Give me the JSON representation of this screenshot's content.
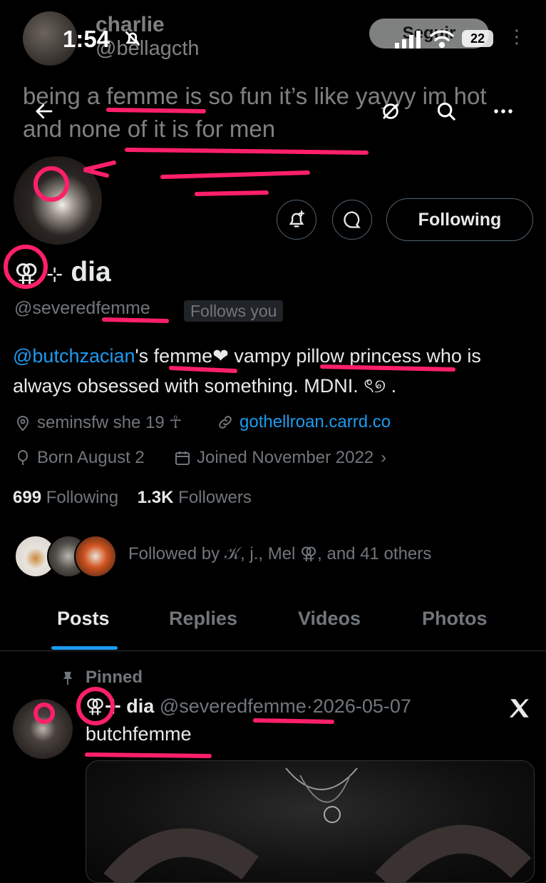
{
  "overlay_tweet": {
    "author_name": "charlie",
    "author_handle": "@bellagcth",
    "follow_label": "Seguir",
    "text": "being a femme is so fun it’s like yayyy im hot and none of it is for men"
  },
  "status_bar": {
    "time": "1:54",
    "battery": "22"
  },
  "profile": {
    "display_name_symbol": "⚢",
    "display_name_sparkle": "⊹",
    "display_name": "dia",
    "handle": "@severedfemme",
    "follows_you": "Follows you",
    "following_label": "Following",
    "bio": {
      "mention": "@butchzacian",
      "rest": "'s femme❤︎ vampy pillow princess who is always obsessed with something. MDNI. ꒰ᐢ .",
      "display_rest": "'s femme❤ vampy pillow princess who is always obsessed with something. MDNI. ৎ୭ ."
    },
    "location": "seminsfw  she  19 ☥",
    "website": "gothellroan.carrd.co",
    "birthday": "Born August 2",
    "joined": "Joined November 2022",
    "following_count": "699",
    "following_text": "Following",
    "followers_count": "1.3K",
    "followers_text": "Followers",
    "followed_by": "Followed by 𝒦, j., Mel ⚢, and 41 others"
  },
  "tabs": [
    "Posts",
    "Replies",
    "Videos",
    "Photos"
  ],
  "pinned_post": {
    "pinned_label": "Pinned",
    "name": "⚢⊹ dia",
    "handle": "@severedfemme",
    "separator": "·",
    "date": "2026-05-07",
    "text": "butchfemme"
  },
  "colors": {
    "accent": "#1d9bf0",
    "annotation": "#ff1f6b",
    "background": "#000000"
  }
}
